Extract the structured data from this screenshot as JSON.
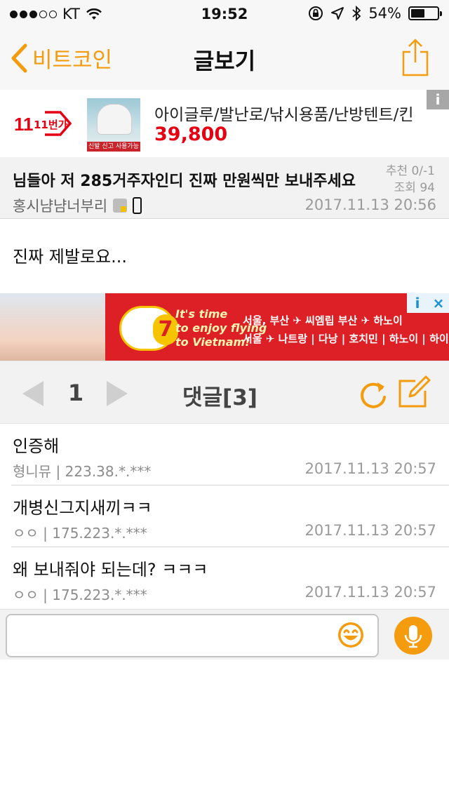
{
  "status_bar": {
    "carrier": "KT",
    "time": "19:52",
    "battery_percent": "54%",
    "battery_level": 0.54,
    "signal_bars_filled": 3,
    "signal_bars_total": 5
  },
  "nav": {
    "back_label": "비트코인",
    "title": "글보기",
    "accent_color": "#f49b0e"
  },
  "product_ad": {
    "brand": "11번가",
    "thumb_label": "신발 신고 사용가능",
    "product_name": "아이글루/발난로/낚시용품/난방텐트/킨",
    "price": "39,800",
    "info_label": "i"
  },
  "post": {
    "title": "님들아 저 285거주자인디 진짜 만원씩만 보내주세요",
    "recommend": "추천 0/-1",
    "views": "조회 94",
    "author": "홍시냠냠너부리",
    "date": "2017.11.13 20:56",
    "content": "진짜 제발로요..."
  },
  "banner_ad": {
    "slogan_1": "It's time",
    "slogan_2": "to enjoy flying",
    "slogan_3": "to Vietnam!",
    "badge_number": "7",
    "route_1": "서울, 부산 ✈ 씨엠립  부산 ✈ 하노이",
    "route_2": "서울 ✈ 나트랑 | 다낭 | 호치민 | 하노이 | 하이퐁",
    "info_icon": "i",
    "close_icon": "×"
  },
  "comments_toolbar": {
    "page_number": "1",
    "comment_count_label": "댓글[3]"
  },
  "comments": [
    {
      "text": "인증해",
      "meta": "형니뮤 | 223.38.*.***",
      "date": "2017.11.13 20:57"
    },
    {
      "text": "개병신그지새끼ㅋㅋ",
      "meta": "ㅇㅇ | 175.223.*.***",
      "date": "2017.11.13 20:57"
    },
    {
      "text": "왜 보내줘야 되는데? ㅋㅋㅋ",
      "meta": "ㅇㅇ | 175.223.*.***",
      "date": "2017.11.13 20:57"
    }
  ],
  "input_bar": {
    "value": "",
    "placeholder": ""
  }
}
